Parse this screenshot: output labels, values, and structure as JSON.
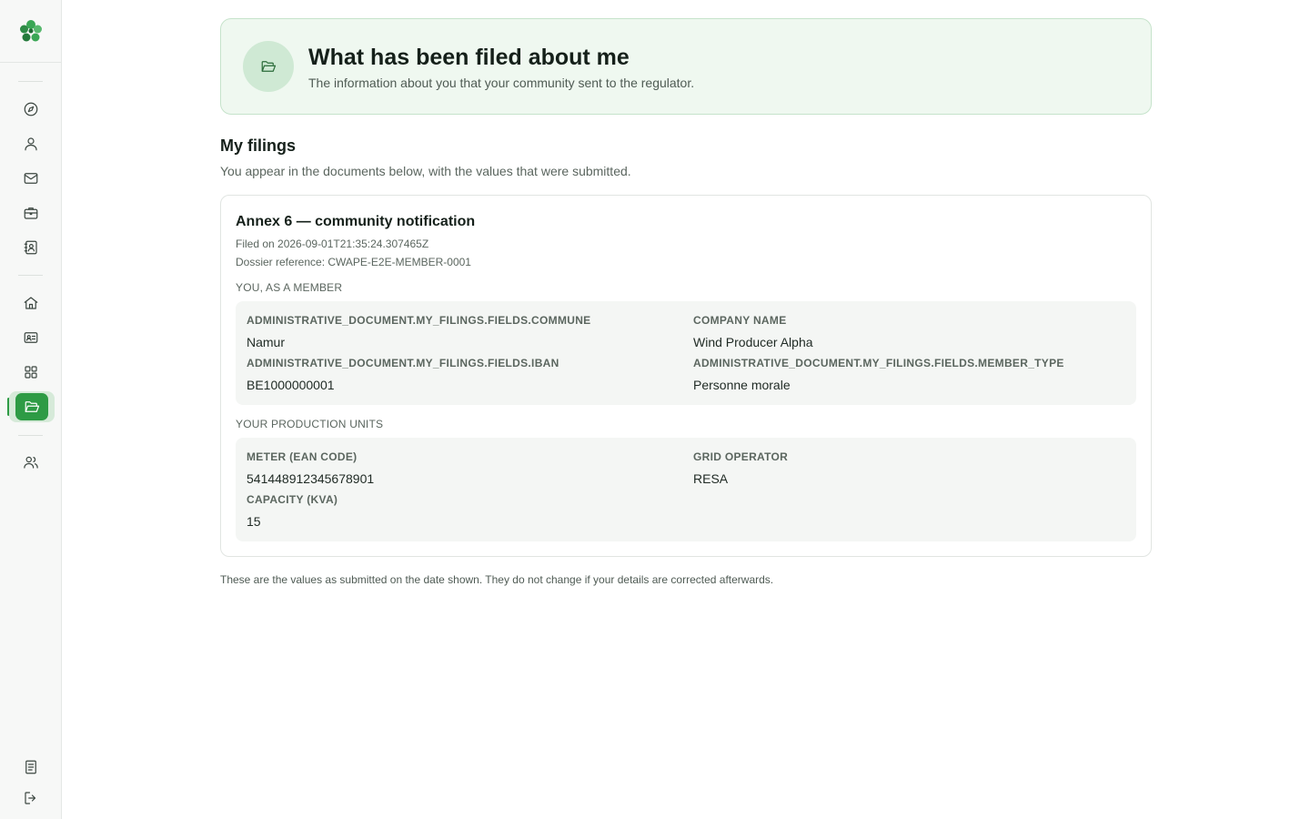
{
  "sidebar": {
    "logo_icon": "clover-logo-icon",
    "nav": [
      {
        "id": "discover",
        "icon": "compass-icon"
      },
      {
        "id": "profile",
        "icon": "user-icon"
      },
      {
        "id": "messages",
        "icon": "mail-icon"
      },
      {
        "id": "business",
        "icon": "briefcase-icon"
      },
      {
        "id": "contacts",
        "icon": "contact-book-icon"
      },
      {
        "id": "home",
        "icon": "home-icon"
      },
      {
        "id": "id-card",
        "icon": "id-card-icon"
      },
      {
        "id": "apps",
        "icon": "grid-icon"
      },
      {
        "id": "filings",
        "icon": "folder-open-icon",
        "active": true
      },
      {
        "id": "community",
        "icon": "users-icon"
      }
    ],
    "bottom": [
      {
        "id": "docs",
        "icon": "document-icon"
      },
      {
        "id": "logout",
        "icon": "logout-icon"
      }
    ]
  },
  "hero": {
    "title": "What has been filed about me",
    "subtitle": "The information about you that your community sent to the regulator.",
    "icon": "folder-open-icon"
  },
  "filings": {
    "title": "My filings",
    "subtitle": "You appear in the documents below, with the values that were submitted."
  },
  "document": {
    "title": "Annex 6 — community notification",
    "filed_on": "Filed on 2026-09-01T21:35:24.307465Z",
    "dossier": "Dossier reference: CWAPE-E2E-MEMBER-0001",
    "member_group": {
      "label": "YOU, AS A MEMBER",
      "fields": [
        {
          "label": "ADMINISTRATIVE_DOCUMENT.MY_FILINGS.FIELDS.COMMUNE",
          "value": "Namur"
        },
        {
          "label": "COMPANY NAME",
          "value": "Wind Producer Alpha"
        },
        {
          "label": "ADMINISTRATIVE_DOCUMENT.MY_FILINGS.FIELDS.IBAN",
          "value": "BE1000000001"
        },
        {
          "label": "ADMINISTRATIVE_DOCUMENT.MY_FILINGS.FIELDS.MEMBER_TYPE",
          "value": "Personne morale"
        }
      ]
    },
    "units_group": {
      "label": "YOUR PRODUCTION UNITS",
      "fields": [
        {
          "label": "METER (EAN CODE)",
          "value": "541448912345678901"
        },
        {
          "label": "GRID OPERATOR",
          "value": "RESA"
        },
        {
          "label": "CAPACITY (KVA)",
          "value": "15"
        }
      ]
    }
  },
  "footnote": "These are the values as submitted on the date shown. They do not change if your details are corrected afterwards.",
  "colors": {
    "accent": "#2e9b45",
    "hero_bg": "#eff8f0",
    "panel_bg": "#f4f6f4"
  }
}
